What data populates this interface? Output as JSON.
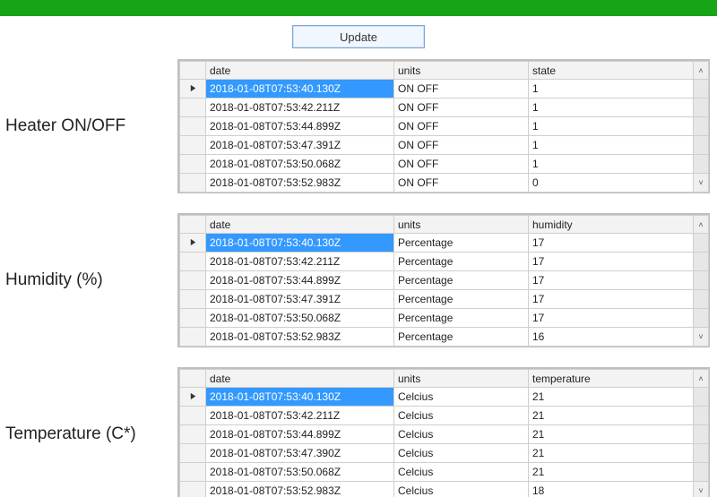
{
  "update_label": "Update",
  "panels": [
    {
      "label": "Heater ON/OFF",
      "columns": [
        "date",
        "units",
        "state"
      ],
      "rows": [
        {
          "date": "2018-01-08T07:53:40.130Z",
          "units": "ON OFF",
          "value": "1",
          "selected": true
        },
        {
          "date": "2018-01-08T07:53:42.211Z",
          "units": "ON OFF",
          "value": "1"
        },
        {
          "date": "2018-01-08T07:53:44.899Z",
          "units": "ON OFF",
          "value": "1"
        },
        {
          "date": "2018-01-08T07:53:47.391Z",
          "units": "ON OFF",
          "value": "1"
        },
        {
          "date": "2018-01-08T07:53:50.068Z",
          "units": "ON OFF",
          "value": "1"
        },
        {
          "date": "2018-01-08T07:53:52.983Z",
          "units": "ON OFF",
          "value": "0"
        }
      ]
    },
    {
      "label": "Humidity (%)",
      "columns": [
        "date",
        "units",
        "humidity"
      ],
      "rows": [
        {
          "date": "2018-01-08T07:53:40.130Z",
          "units": "Percentage",
          "value": "17",
          "selected": true
        },
        {
          "date": "2018-01-08T07:53:42.211Z",
          "units": "Percentage",
          "value": "17"
        },
        {
          "date": "2018-01-08T07:53:44.899Z",
          "units": "Percentage",
          "value": "17"
        },
        {
          "date": "2018-01-08T07:53:47.391Z",
          "units": "Percentage",
          "value": "17"
        },
        {
          "date": "2018-01-08T07:53:50.068Z",
          "units": "Percentage",
          "value": "17"
        },
        {
          "date": "2018-01-08T07:53:52.983Z",
          "units": "Percentage",
          "value": "16"
        }
      ]
    },
    {
      "label": "Temperature (C*)",
      "columns": [
        "date",
        "units",
        "temperature"
      ],
      "rows": [
        {
          "date": "2018-01-08T07:53:40.130Z",
          "units": "Celcius",
          "value": "21",
          "selected": true
        },
        {
          "date": "2018-01-08T07:53:42.211Z",
          "units": "Celcius",
          "value": "21"
        },
        {
          "date": "2018-01-08T07:53:44.899Z",
          "units": "Celcius",
          "value": "21"
        },
        {
          "date": "2018-01-08T07:53:47.390Z",
          "units": "Celcius",
          "value": "21"
        },
        {
          "date": "2018-01-08T07:53:50.068Z",
          "units": "Celcius",
          "value": "21"
        },
        {
          "date": "2018-01-08T07:53:52.983Z",
          "units": "Celcius",
          "value": "18"
        }
      ]
    }
  ]
}
